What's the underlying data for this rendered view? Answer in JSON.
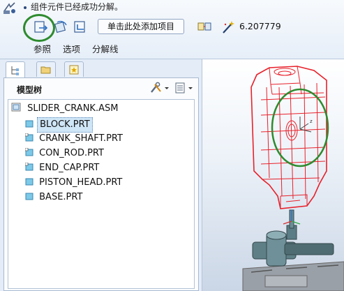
{
  "dashboard": {
    "message": "组件元件已经成功分解。",
    "collector_label": "单击此处添加项目",
    "value": "6.207779",
    "tabs": [
      "参照",
      "选项",
      "分解线"
    ]
  },
  "left_panel": {
    "title": "模型树",
    "tree": [
      {
        "label": "SLIDER_CRANK.ASM"
      },
      {
        "label": "BLOCK.PRT"
      },
      {
        "label": "CRANK_SHAFT.PRT"
      },
      {
        "label": "CON_ROD.PRT"
      },
      {
        "label": "END_CAP.PRT"
      },
      {
        "label": "PISTON_HEAD.PRT"
      },
      {
        "label": "BASE.PRT"
      }
    ]
  },
  "colors": {
    "highlight_circle": "#2e8b2e",
    "model_red": "#e8202a",
    "selection_fill": "#cfe6f7"
  }
}
